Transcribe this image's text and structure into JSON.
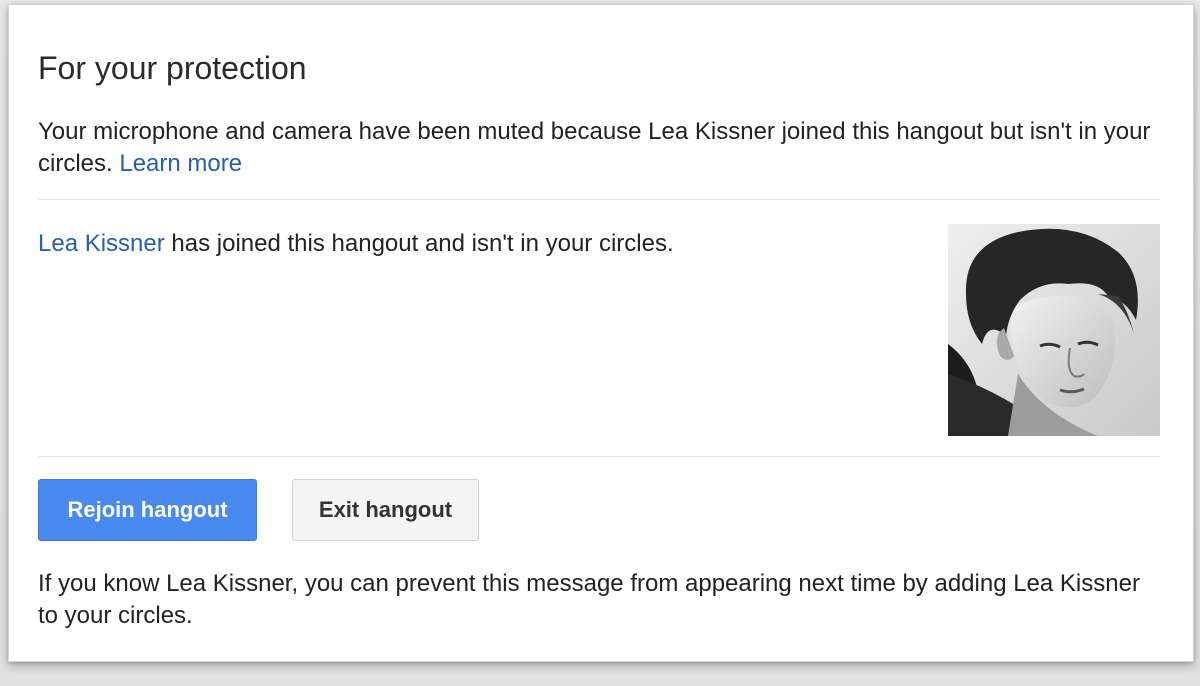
{
  "dialog": {
    "title": "For your protection",
    "muted_notice": {
      "text": "Your microphone and camera have been muted because Lea Kissner joined this hangout but isn't in your circles.",
      "link": "Learn more"
    },
    "joined_notice": {
      "name_link": "Lea Kissner",
      "text": " has joined this hangout and isn't in your circles."
    },
    "buttons": {
      "rejoin": "Rejoin hangout",
      "exit": "Exit hangout"
    },
    "footer_text": "If you know Lea Kissner, you can prevent this message from appearing next time by adding Lea Kissner to your circles."
  },
  "colors": {
    "link": "#2a5db0",
    "primary_button": "#4a8af0",
    "secondary_button": "#f4f4f4"
  },
  "icons": {
    "avatar": "user-profile-photo"
  }
}
